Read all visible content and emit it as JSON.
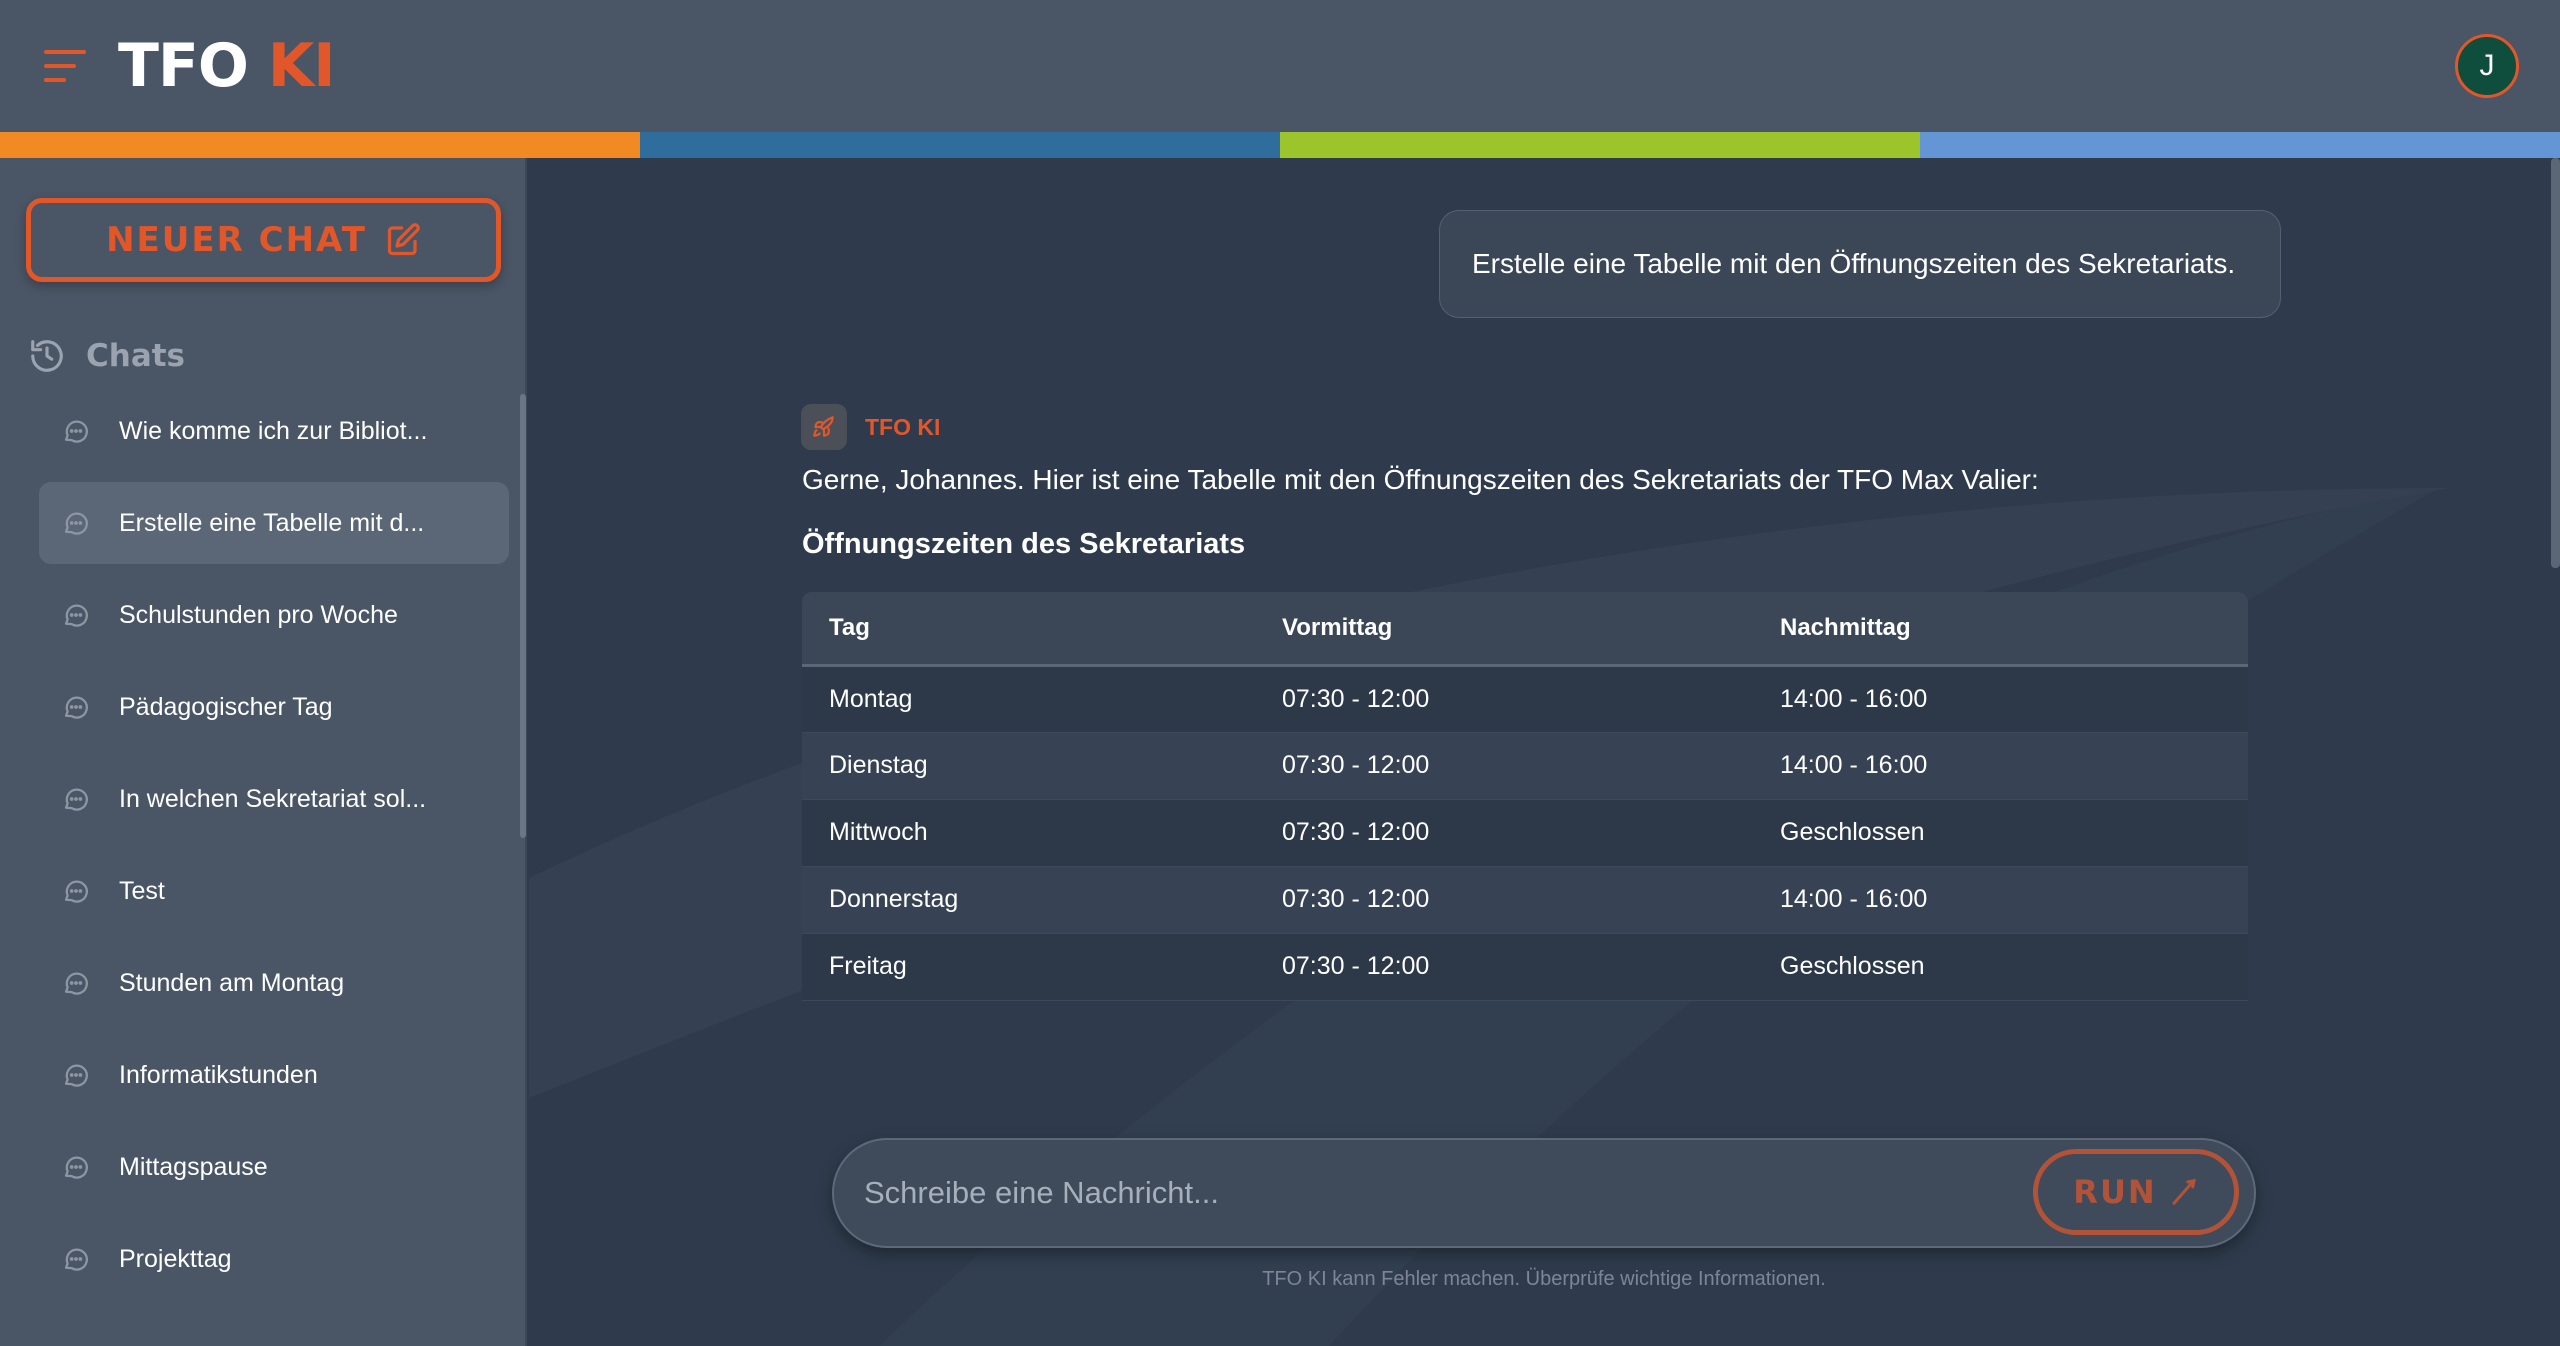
{
  "app": {
    "logo_white": "TFO",
    "logo_orange": " KI",
    "user_initial": "J"
  },
  "colors": {
    "accent": "#e2572a",
    "bar": [
      "#f28a24",
      "#2f6e9c",
      "#9bc52a",
      "#6495d4"
    ]
  },
  "sidebar": {
    "new_chat_label": "NEUER CHAT",
    "chats_heading": "Chats",
    "items": [
      {
        "label": "Wie komme ich zur Bibliot..."
      },
      {
        "label": "Erstelle eine Tabelle mit d..."
      },
      {
        "label": "Schulstunden pro Woche"
      },
      {
        "label": "Pädagogischer Tag"
      },
      {
        "label": "In welchen Sekretariat sol..."
      },
      {
        "label": "Test"
      },
      {
        "label": "Stunden am Montag"
      },
      {
        "label": "Informatikstunden"
      },
      {
        "label": "Mittagspause"
      },
      {
        "label": "Projekttag"
      }
    ],
    "active_index": 1
  },
  "conversation": {
    "user_message": "Erstelle eine Tabelle mit den Öffnungszeiten des Sekretariats.",
    "bot_name": "TFO KI",
    "bot_intro": "Gerne, Johannes. Hier ist eine Tabelle mit den Öffnungszeiten des Sekretariats der TFO Max Valier:",
    "table_title": "Öffnungszeiten des Sekretariats",
    "table": {
      "headers": [
        "Tag",
        "Vormittag",
        "Nachmittag"
      ],
      "rows": [
        [
          "Montag",
          "07:30 - 12:00",
          "14:00 - 16:00"
        ],
        [
          "Dienstag",
          "07:30 - 12:00",
          "14:00 - 16:00"
        ],
        [
          "Mittwoch",
          "07:30 - 12:00",
          "Geschlossen"
        ],
        [
          "Donnerstag",
          "07:30 - 12:00",
          "14:00 - 16:00"
        ],
        [
          "Freitag",
          "07:30 - 12:00",
          "Geschlossen"
        ]
      ]
    }
  },
  "composer": {
    "placeholder": "Schreibe eine Nachricht...",
    "run_label": "RUN",
    "disclaimer": "TFO KI kann Fehler machen. Überprüfe wichtige Informationen."
  }
}
